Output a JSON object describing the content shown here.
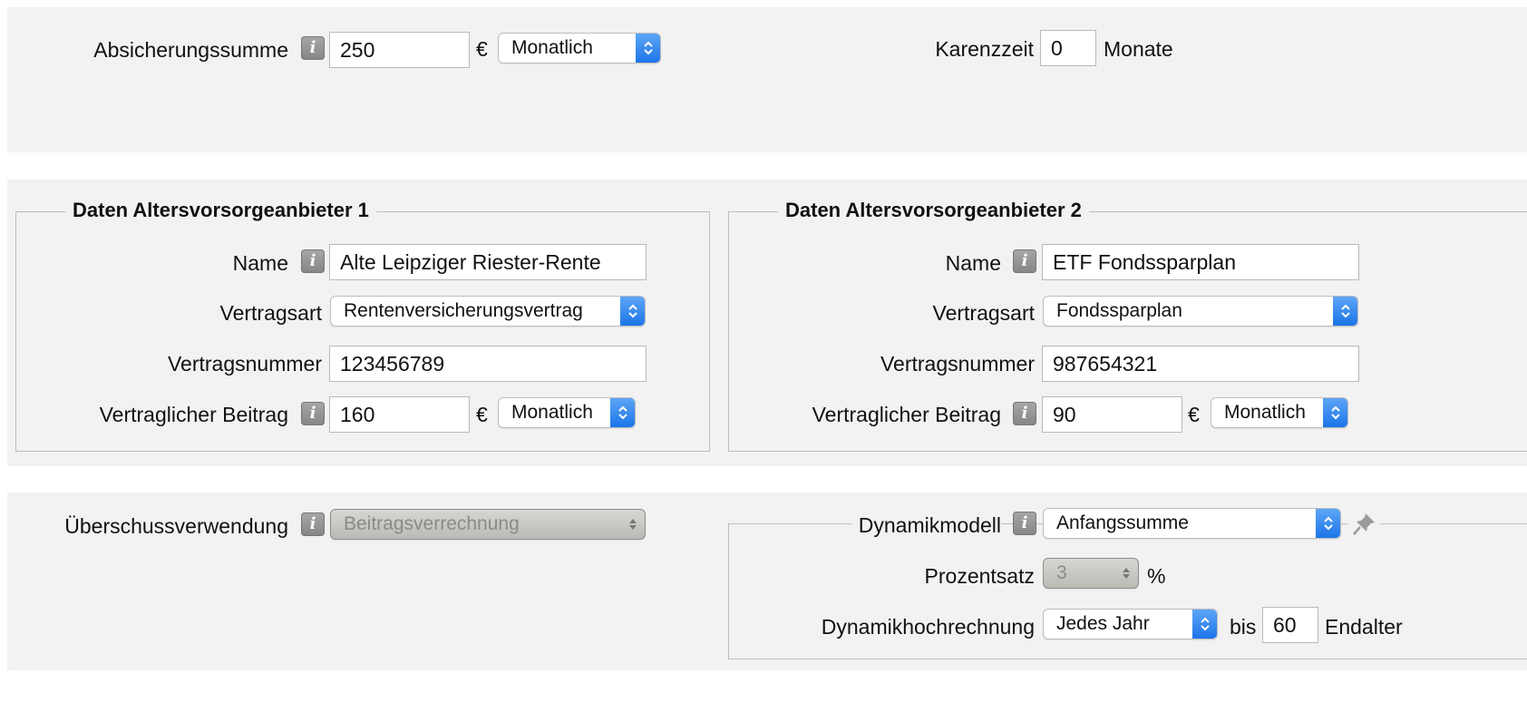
{
  "top": {
    "absicherungssumme_label": "Absicherungssumme",
    "absicherungssumme_value": "250",
    "currency": "€",
    "interval": "Monatlich",
    "karenzzeit_label": "Karenzzeit",
    "karenzzeit_value": "0",
    "karenzzeit_unit": "Monate"
  },
  "provider1": {
    "title": "Daten Altersvorsorgeanbieter 1",
    "name_label": "Name",
    "name_value": "Alte Leipziger Riester-Rente",
    "vertragsart_label": "Vertragsart",
    "vertragsart_value": "Rentenversicherungsvertrag",
    "vertragsnummer_label": "Vertragsnummer",
    "vertragsnummer_value": "123456789",
    "beitrag_label": "Vertraglicher Beitrag",
    "beitrag_value": "160",
    "currency": "€",
    "interval": "Monatlich"
  },
  "provider2": {
    "title": "Daten Altersvorsorgeanbieter 2",
    "name_label": "Name",
    "name_value": "ETF Fondssparplan",
    "vertragsart_label": "Vertragsart",
    "vertragsart_value": "Fondssparplan",
    "vertragsnummer_label": "Vertragsnummer",
    "vertragsnummer_value": "987654321",
    "beitrag_label": "Vertraglicher Beitrag",
    "beitrag_value": "90",
    "currency": "€",
    "interval": "Monatlich"
  },
  "bottom": {
    "ueberschuss_label": "Überschussverwendung",
    "ueberschuss_value": "Beitragsverrechnung",
    "dynamik_label": "Dynamikmodell",
    "dynamik_value": "Anfangssumme",
    "prozentsatz_label": "Prozentsatz",
    "prozentsatz_value": "3",
    "prozent_unit": "%",
    "hochrechnung_label": "Dynamikhochrechnung",
    "hochrechnung_value": "Jedes Jahr",
    "bis_label": "bis",
    "endalter_value": "60",
    "endalter_label": "Endalter"
  },
  "icons": {
    "info": "info-icon",
    "pin": "pin-icon",
    "select": "select-arrows-icon"
  },
  "colors": {
    "accent": "#1a73e8",
    "panel": "#f2f2f2"
  }
}
